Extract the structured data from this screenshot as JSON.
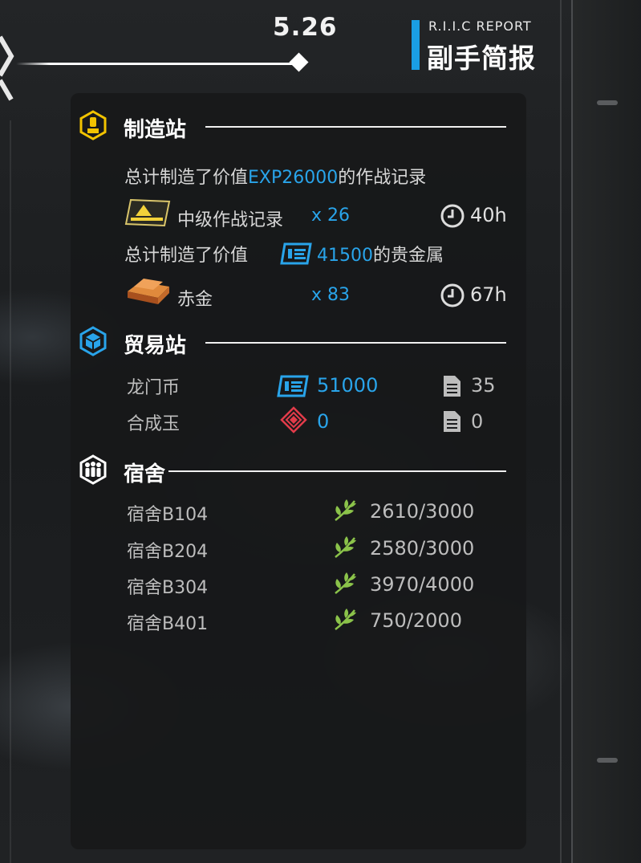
{
  "header": {
    "date": "5.26",
    "report_sub": "R.I.I.C REPORT",
    "report_title": "副手简报"
  },
  "manufacturing": {
    "title": "制造站",
    "summary1": {
      "prefix": "总计制造了价值",
      "value": "EXP26000",
      "suffix": "的作战记录"
    },
    "item1": {
      "name": "中级作战记录",
      "count": "x 26",
      "time": "40h",
      "icon": "battle-record-icon"
    },
    "summary2": {
      "prefix": "总计制造了价值",
      "value": "41500",
      "suffix": "的贵金属",
      "icon": "lmd-icon"
    },
    "item2": {
      "name": "赤金",
      "count": "x 83",
      "time": "67h",
      "icon": "gold-bar-icon"
    }
  },
  "trading": {
    "title": "贸易站",
    "rows": [
      {
        "name": "龙门币",
        "value": "51000",
        "orders": "35",
        "icon": "lmd-icon"
      },
      {
        "name": "合成玉",
        "value": "0",
        "orders": "0",
        "icon": "orundum-icon"
      }
    ]
  },
  "dormitory": {
    "title": "宿舍",
    "rows": [
      {
        "name": "宿舍B104",
        "ambience": "2610/3000"
      },
      {
        "name": "宿舍B204",
        "ambience": "2580/3000"
      },
      {
        "name": "宿舍B304",
        "ambience": "3970/4000"
      },
      {
        "name": "宿舍B401",
        "ambience": "750/2000"
      }
    ]
  },
  "colors": {
    "accent": "#29a4ea",
    "gold": "#f2c300",
    "green": "#8bc34a",
    "text": "#d6d6d6"
  }
}
